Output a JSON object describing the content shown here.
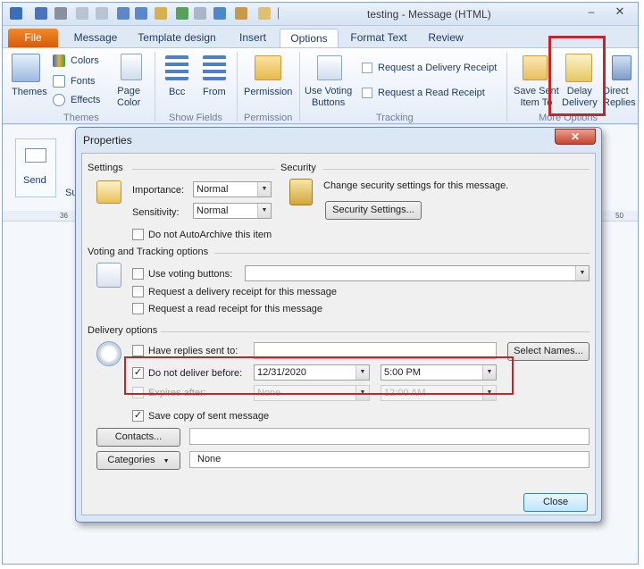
{
  "window": {
    "title": "testing  -  Message (HTML)",
    "min_glyph": "–",
    "close_glyph": "✕"
  },
  "tabs": [
    {
      "label": "File"
    },
    {
      "label": "Message"
    },
    {
      "label": "Template design"
    },
    {
      "label": "Insert"
    },
    {
      "label": "Options"
    },
    {
      "label": "Format Text"
    },
    {
      "label": "Review"
    }
  ],
  "ribbon": {
    "themes_group": {
      "themes": "Themes",
      "colors": "Colors",
      "fonts": "Fonts",
      "effects": "Effects",
      "page_color": "Page\nColor",
      "label": "Themes"
    },
    "show_fields_group": {
      "bcc": "Bcc",
      "from": "From",
      "label": "Show Fields"
    },
    "permission_group": {
      "permission": "Permission",
      "label": "Permission"
    },
    "tracking_group": {
      "use_voting": "Use Voting\nButtons",
      "request_delivery": "Request a Delivery Receipt",
      "request_read": "Request a Read Receipt",
      "label": "Tracking"
    },
    "more_options_group": {
      "save_sent": "Save Sent\nItem To",
      "delay_delivery": "Delay\nDelivery",
      "direct_replies": "Direct\nReplies",
      "label": "More Options"
    }
  },
  "message_pane": {
    "send": "Send",
    "subject_partial": "Su"
  },
  "ruler": {
    "marks": [
      "36",
      "50"
    ]
  },
  "dialog": {
    "title": "Properties",
    "close_glyph": "✕",
    "settings": {
      "heading": "Settings",
      "importance_label": "Importance:",
      "importance_value": "Normal",
      "sensitivity_label": "Sensitivity:",
      "sensitivity_value": "Normal",
      "autoarchive_label": "Do not AutoArchive this item"
    },
    "security": {
      "heading": "Security",
      "text": "Change security settings for this message.",
      "button": "Security Settings..."
    },
    "voting": {
      "heading": "Voting and Tracking options",
      "use_voting_label": "Use voting buttons:",
      "delivery_receipt_label": "Request a delivery receipt for this message",
      "read_receipt_label": "Request a read receipt for this message"
    },
    "delivery": {
      "heading": "Delivery options",
      "replies_label": "Have replies sent to:",
      "select_names_button": "Select Names...",
      "deliver_before_label": "Do not deliver before:",
      "deliver_before_date": "12/31/2020",
      "deliver_before_time": "5:00 PM",
      "expires_label": "Expires after:",
      "expires_date": "None",
      "expires_time": "12:00 AM",
      "save_copy_label": "Save copy of sent message",
      "check_glyph": "✓"
    },
    "contacts_button": "Contacts...",
    "categories_button": "Categories",
    "categories_value": "None",
    "close_button": "Close"
  }
}
